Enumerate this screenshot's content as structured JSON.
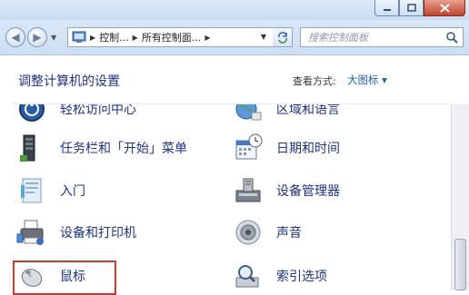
{
  "address": {
    "crumbs": [
      "控制...",
      "所有控制面...",
      ""
    ],
    "search_placeholder": "搜索控制面板"
  },
  "header": {
    "title": "调整计算机的设置",
    "view_by_label": "查看方式:",
    "view_by_value": "大图标 ▾"
  },
  "items_left": [
    {
      "label": "轻松访问中心",
      "icon": "ease-of-access-icon"
    },
    {
      "label": "任务栏和「开始」菜单",
      "icon": "taskbar-icon"
    },
    {
      "label": "入门",
      "icon": "getting-started-icon"
    },
    {
      "label": "设备和打印机",
      "icon": "printer-icon"
    },
    {
      "label": "鼠标",
      "icon": "mouse-icon"
    }
  ],
  "items_right": [
    {
      "label": "区域和语言",
      "icon": "region-globe-icon"
    },
    {
      "label": "日期和时间",
      "icon": "calendar-clock-icon"
    },
    {
      "label": "设备管理器",
      "icon": "device-manager-icon"
    },
    {
      "label": "声音",
      "icon": "speaker-icon"
    },
    {
      "label": "索引选项",
      "icon": "index-options-icon"
    }
  ]
}
